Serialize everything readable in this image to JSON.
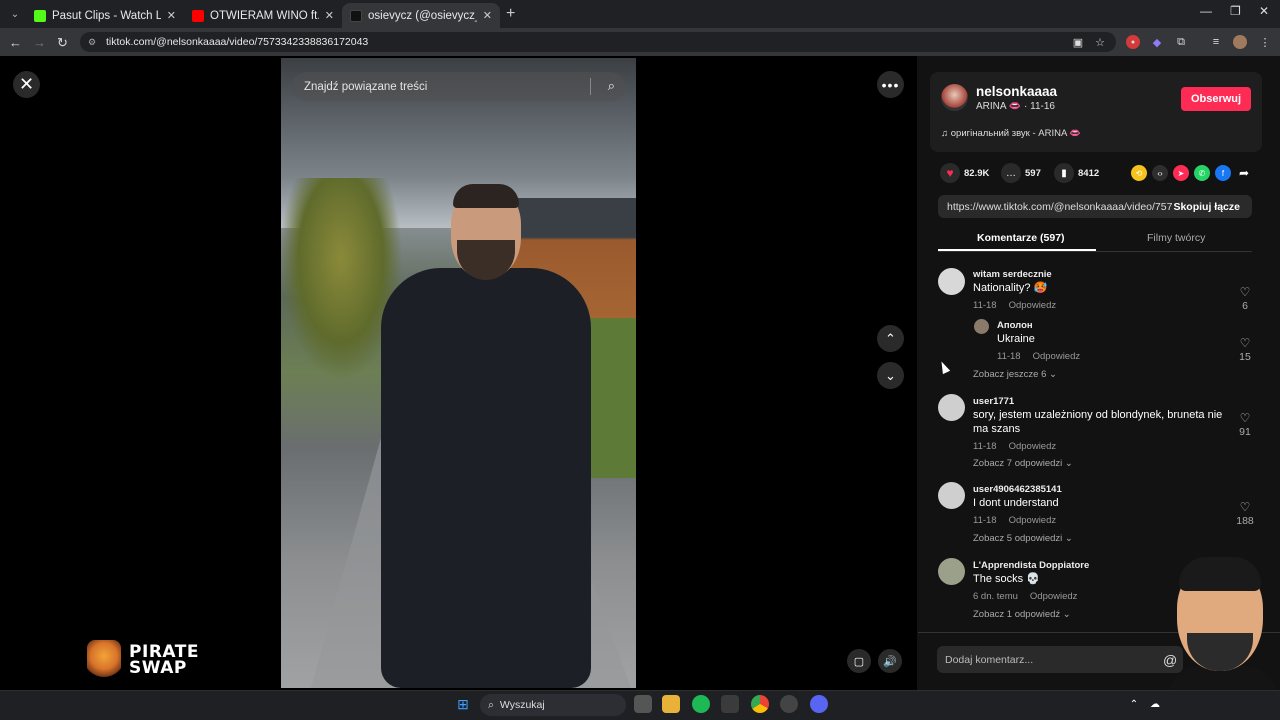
{
  "browser": {
    "tabs": [
      {
        "title": "Pasut Clips - Watch Live on Kick",
        "fav_color": "#53fc18"
      },
      {
        "title": "OTWIERAM WINO ft. OTSOCHODZI",
        "fav_color": "#ff0000"
      },
      {
        "title": "osievycz (@osievycz_) | TikTok",
        "fav_color": "#000000"
      }
    ],
    "url": "tiktok.com/@nelsonkaaaa/video/7573342338836172043"
  },
  "video": {
    "search_placeholder": "Znajdź powiązane treści"
  },
  "author": {
    "username": "nelsonkaaaa",
    "display": "ARINA 👄 · 11-16",
    "follow_label": "Obserwuj",
    "sound": "♫  оригінальний звук - ARINA 👄"
  },
  "stats": {
    "likes": "82.9K",
    "comments": "597",
    "saves": "8412"
  },
  "link": {
    "url": "https://www.tiktok.com/@nelsonkaaaa/video/757...",
    "copy_label": "Skopiuj łącze"
  },
  "panel_tabs": {
    "comments": "Komentarze (597)",
    "creator_videos": "Filmy twórcy"
  },
  "comments": [
    {
      "user": "witam serdecznie",
      "text": "Nationality? 🥵",
      "date": "11-18",
      "reply": "Odpowiedz",
      "likes": "6"
    },
    {
      "user": "Аполон",
      "text": "Ukraine",
      "date": "11-18",
      "reply": "Odpowiedz",
      "likes": "15"
    },
    {
      "more": "Zobacz jeszcze 6 ⌄"
    },
    {
      "user": "user1771",
      "text": "sory, jestem uzależniony od blondynek, bruneta nie ma szans",
      "date": "11-18",
      "reply": "Odpowiedz",
      "likes": "91",
      "more": "Zobacz 7 odpowiedzi ⌄"
    },
    {
      "user": "user4906462385141",
      "text": "I dont understand",
      "date": "11-18",
      "reply": "Odpowiedz",
      "likes": "188",
      "more": "Zobacz 5 odpowiedzi ⌄"
    },
    {
      "user": "L'Apprendista Doppiatore",
      "text": "The socks 💀",
      "date": "6 dn. temu",
      "reply": "Odpowiedz",
      "more": "Zobacz 1 odpowiedź ⌄"
    }
  ],
  "add_comment_placeholder": "Dodaj komentarz...",
  "sponsor": {
    "line1": "PIRATE",
    "line2": "SWAP"
  },
  "taskbar": {
    "search_label": "Wyszukaj"
  }
}
